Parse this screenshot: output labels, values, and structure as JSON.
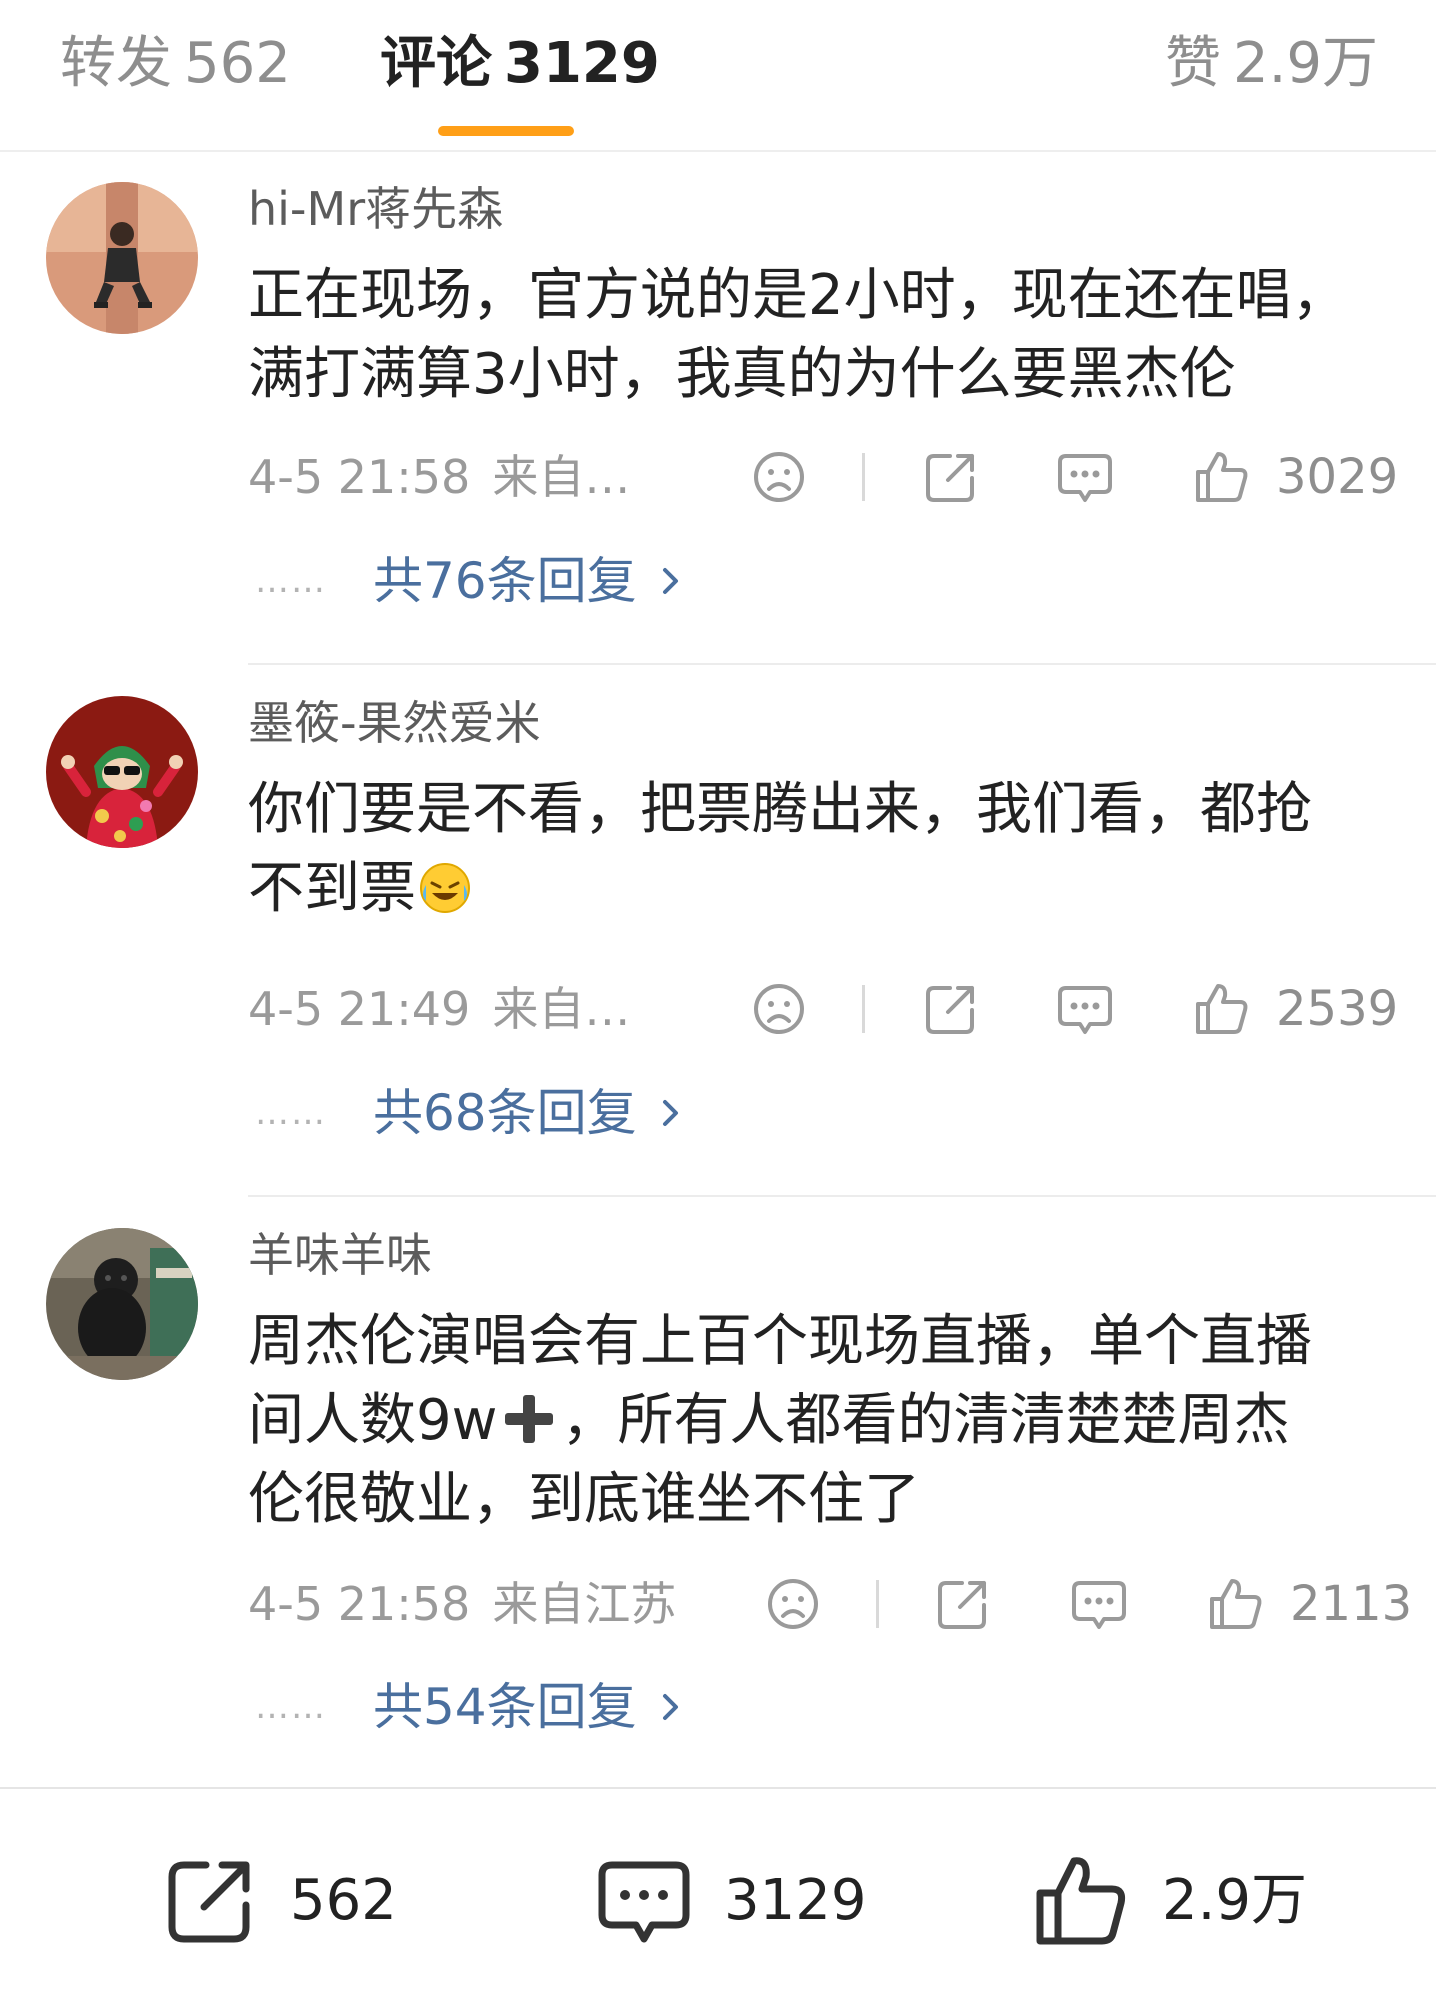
{
  "tabs": {
    "reposts_label": "转发",
    "reposts_count": "562",
    "comments_label": "评论",
    "comments_count": "3129",
    "likes_label": "赞",
    "likes_count": "2.9万"
  },
  "colors": {
    "accent": "#ff9f17",
    "link": "#4a6f9e",
    "meta": "#9a9a9a"
  },
  "icons": {
    "dislike": "frown-face-icon",
    "repost": "share-box-icon",
    "comment": "speech-bubble-icon",
    "like": "thumbs-up-icon"
  },
  "comments": [
    {
      "username": "hi-Mr蒋先森",
      "lines": [
        "正在现场，官方说的是2小时，现在还在唱，",
        "满打满算3小时，我真的为什么要黑杰伦"
      ],
      "time": "4-5 21:58",
      "location": "来自…",
      "likes": "3029",
      "dots": "……",
      "replies": "共76条回复"
    },
    {
      "username": "墨筱-果然爱米",
      "lines": [
        "你们要是不看，把票腾出来，我们看，都抢",
        "不到票"
      ],
      "emoji": "laughing-tears-emoji",
      "time": "4-5 21:49",
      "location": "来自…",
      "likes": "2539",
      "dots": "……",
      "replies": "共68条回复"
    },
    {
      "username": "羊味羊味",
      "lines": [
        "周杰伦演唱会有上百个现场直播，单个直播",
        "间人数9w",
        "，所有人都看的清清楚楚周杰",
        "伦很敬业，到底谁坐不住了"
      ],
      "emoji": "heavy-plus-emoji",
      "time": "4-5 21:58",
      "location": "来自江苏",
      "likes": "2113",
      "dots": "……",
      "replies": "共54条回复"
    }
  ],
  "bottom_bar": {
    "repost_count": "562",
    "comment_count": "3129",
    "like_count": "2.9万"
  }
}
